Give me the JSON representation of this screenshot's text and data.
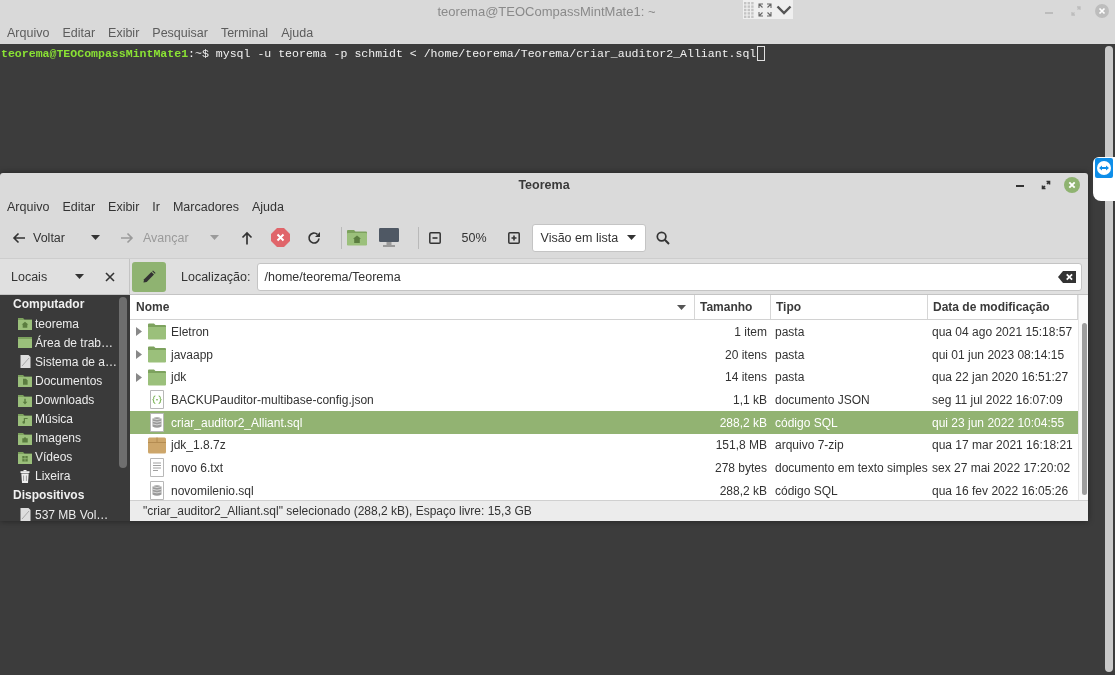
{
  "terminal": {
    "title": "teorema@TEOCompassMintMate1: ~",
    "menu": [
      "Arquivo",
      "Editar",
      "Exibir",
      "Pesquisar",
      "Terminal",
      "Ajuda"
    ],
    "prompt": {
      "user_host": "teorema@TEOCompassMintMate1",
      "separator": ":~$",
      "command": "mysql -u teorema -p schmidt < /home/teorema/Teorema/criar_auditor2_Alliant.sql"
    }
  },
  "file_manager": {
    "title": "Teorema",
    "menu": [
      "Arquivo",
      "Editar",
      "Exibir",
      "Ir",
      "Marcadores",
      "Ajuda"
    ],
    "toolbar": {
      "nav": [
        {
          "kind": "back",
          "label": "Voltar",
          "disabled": false
        },
        {
          "kind": "forward",
          "label": "Avançar",
          "disabled": true
        }
      ],
      "zoom": "50%",
      "view": "Visão em lista"
    },
    "sidebar": {
      "title": "Locais",
      "sections": [
        {
          "title": "Computador",
          "items": [
            {
              "kind": "home",
              "label": "teorema",
              "selected": false
            },
            {
              "kind": "desktop",
              "label": "Área de trab…",
              "selected": false
            },
            {
              "kind": "drive",
              "label": "Sistema de a…",
              "selected": false
            },
            {
              "kind": "documents",
              "label": "Documentos",
              "selected": false
            },
            {
              "kind": "downloads",
              "label": "Downloads",
              "selected": false
            },
            {
              "kind": "music",
              "label": "Música",
              "selected": false
            },
            {
              "kind": "pictures",
              "label": "Imagens",
              "selected": false
            },
            {
              "kind": "videos",
              "label": "Vídeos",
              "selected": false
            },
            {
              "kind": "trash",
              "label": "Lixeira",
              "selected": false
            }
          ]
        },
        {
          "title": "Dispositivos",
          "items": [
            {
              "kind": "drive",
              "label": "537 MB Vol…",
              "selected": false
            }
          ]
        }
      ]
    },
    "location": {
      "label": "Localização:",
      "value": "/home/teorema/Teorema"
    },
    "table": {
      "columns": [
        {
          "label": "Nome",
          "sorted": true
        },
        {
          "label": "Tamanho",
          "sorted": false
        },
        {
          "label": "Tipo",
          "sorted": false
        },
        {
          "label": "Data de modificação",
          "sorted": false
        }
      ],
      "rows": [
        {
          "kind": "folder",
          "name": "Eletron",
          "size": "1 item",
          "type": "pasta",
          "modified": "qua 04 ago 2021 15:18:57",
          "selected": false
        },
        {
          "kind": "folder",
          "name": "javaapp",
          "size": "20 itens",
          "type": "pasta",
          "modified": "qui 01 jun 2023 08:14:15",
          "selected": false
        },
        {
          "kind": "folder",
          "name": "jdk",
          "size": "14 itens",
          "type": "pasta",
          "modified": "qua 22 jan 2020 16:51:27",
          "selected": false
        },
        {
          "kind": "json",
          "name": "BACKUPauditor-multibase-config.json",
          "size": "1,1 kB",
          "type": "documento JSON",
          "modified": "seg 11 jul 2022 16:07:09",
          "selected": false
        },
        {
          "kind": "sql",
          "name": "criar_auditor2_Alliant.sql",
          "size": "288,2 kB",
          "type": "código SQL",
          "modified": "qui 23 jun 2022 10:04:55",
          "selected": true
        },
        {
          "kind": "archive",
          "name": "jdk_1.8.7z",
          "size": "151,8 MB",
          "type": "arquivo 7-zip",
          "modified": "qua 17 mar 2021 16:18:21",
          "selected": false
        },
        {
          "kind": "text",
          "name": "novo 6.txt",
          "size": "278 bytes",
          "type": "documento em texto simples",
          "modified": "sex 27 mai 2022 17:20:02",
          "selected": false
        },
        {
          "kind": "sql",
          "name": "novomilenio.sql",
          "size": "288,2 kB",
          "type": "código SQL",
          "modified": "qua 16 fev 2022 16:05:26",
          "selected": false
        }
      ]
    },
    "status_bar": "\"criar_auditor2_Alliant.sql\" selecionado (288,2 kB), Espaço livre: 15,3 GB"
  }
}
